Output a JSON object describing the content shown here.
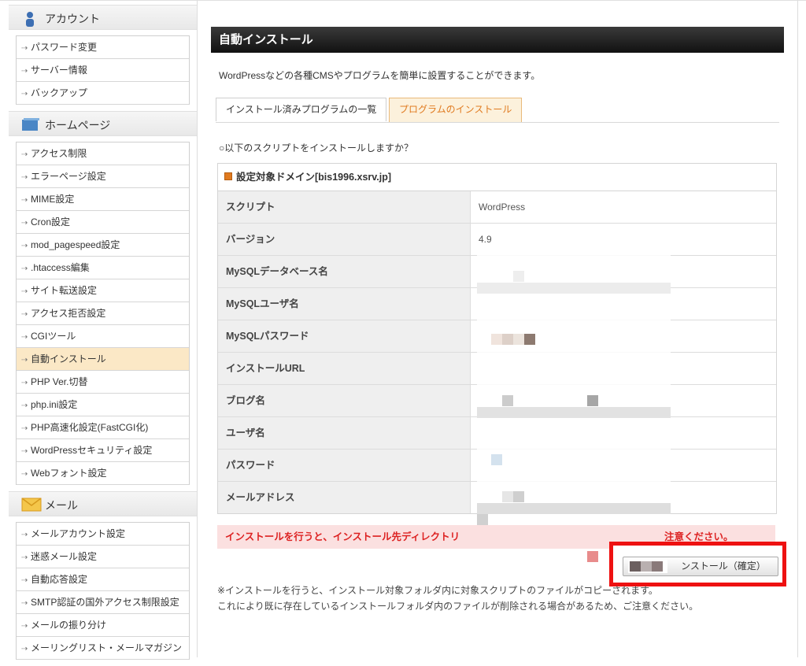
{
  "sidebar": {
    "sections": [
      {
        "title": "アカウント",
        "icon": "person-icon",
        "items": [
          "パスワード変更",
          "サーバー情報",
          "バックアップ"
        ]
      },
      {
        "title": "ホームページ",
        "icon": "homepage-icon",
        "items": [
          "アクセス制限",
          "エラーページ設定",
          "MIME設定",
          "Cron設定",
          "mod_pagespeed設定",
          ".htaccess編集",
          "サイト転送設定",
          "アクセス拒否設定",
          "CGIツール",
          "自動インストール",
          "PHP Ver.切替",
          "php.ini設定",
          "PHP高速化設定(FastCGI化)",
          "WordPressセキュリティ設定",
          "Webフォント設定"
        ]
      },
      {
        "title": "メール",
        "icon": "mail-icon",
        "items": [
          "メールアカウント設定",
          "迷惑メール設定",
          "自動応答設定",
          "SMTP認証の国外アクセス制限設定",
          "メールの振り分け",
          "メーリングリスト・メールマガジン"
        ]
      }
    ],
    "active_item": "自動インストール"
  },
  "main": {
    "title": "自動インストール",
    "description": "WordPressなどの各種CMSやプログラムを簡単に設置することができます。",
    "tabs": [
      {
        "label": "インストール済みプログラムの一覧",
        "active": false
      },
      {
        "label": "プログラムのインストール",
        "active": true
      }
    ],
    "question": "○以下のスクリプトをインストールしますか？",
    "box_title": "設定対象ドメイン[bis1996.xsrv.jp]",
    "rows": [
      {
        "label": "スクリプト",
        "value": "WordPress"
      },
      {
        "label": "バージョン",
        "value": "4.9"
      },
      {
        "label": "MySQLデータベース名",
        "value": ""
      },
      {
        "label": "MySQLユーザ名",
        "value": ""
      },
      {
        "label": "MySQLパスワード",
        "value": ""
      },
      {
        "label": "インストールURL",
        "value": ""
      },
      {
        "label": "ブログ名",
        "value": ""
      },
      {
        "label": "ユーザ名",
        "value": ""
      },
      {
        "label": "パスワード",
        "value": ""
      },
      {
        "label": "メールアドレス",
        "value": ""
      }
    ],
    "warning_text": "インストールを行うと、インストール先ディレクトリ",
    "warning_tail": "注意ください。",
    "confirm_label": "インストール（確定）",
    "confirm_visible": "ンストール（確定）",
    "note_lines": [
      "※インストールを行うと、インストール対象フォルダ内に対象スクリプトのファイルがコピーされます。",
      "これにより既に存在しているインストールフォルダ内のファイルが削除される場合があるため、ご注意ください。"
    ]
  },
  "colors": {
    "accent_orange": "#e07a1f",
    "highlight_red": "#ee1111",
    "active_menu_bg": "#fbe8c6",
    "warning_bg": "#fbe0e0",
    "warning_text": "#dd2222"
  }
}
